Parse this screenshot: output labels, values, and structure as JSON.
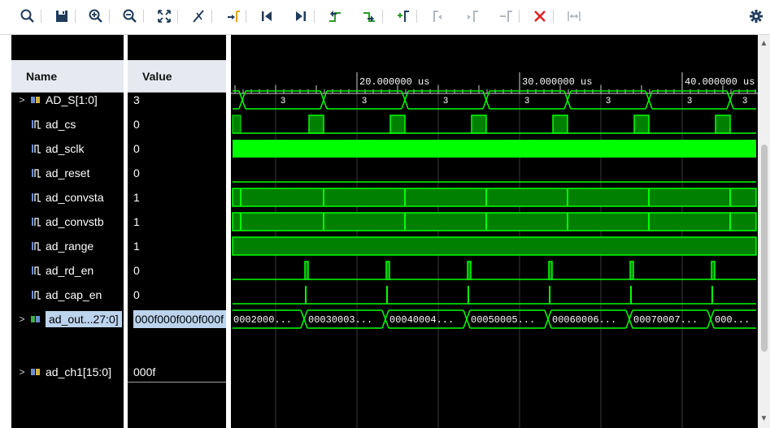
{
  "toolbar": {
    "buttons": [
      {
        "name": "search-icon",
        "title": "Search"
      },
      {
        "name": "save-icon",
        "title": "Save Waveform Configuration"
      },
      {
        "name": "zoom-in-icon",
        "title": "Zoom In"
      },
      {
        "name": "zoom-out-icon",
        "title": "Zoom Out"
      },
      {
        "name": "zoom-fit-icon",
        "title": "Zoom Fit"
      },
      {
        "name": "cursor-to-transition-icon",
        "title": "Zoom to Cursor"
      },
      {
        "name": "go-to-cursor-icon",
        "title": "Go To Cursor"
      },
      {
        "name": "go-to-time-zero-icon",
        "title": "Go To Time 0"
      },
      {
        "name": "go-to-last-time-icon",
        "title": "Go To Last Time"
      },
      {
        "name": "previous-transition-icon",
        "title": "Previous Transition"
      },
      {
        "name": "next-transition-icon",
        "title": "Next Transition"
      },
      {
        "name": "add-marker-icon",
        "title": "Add Marker"
      },
      {
        "name": "previous-marker-icon",
        "title": "Previous Marker"
      },
      {
        "name": "next-marker-icon",
        "title": "Next Marker"
      },
      {
        "name": "swap-cursors-icon",
        "title": "Swap Cursors"
      },
      {
        "name": "delete-icon",
        "title": "Delete"
      },
      {
        "name": "snap-to-transition-icon",
        "title": "Snap to Transition"
      },
      {
        "name": "settings-icon",
        "title": "Settings"
      }
    ]
  },
  "columns": {
    "name": "Name",
    "value": "Value"
  },
  "signals": [
    {
      "name": "AD_S[1:0]",
      "value": "3",
      "type": "bus",
      "expandable": true
    },
    {
      "name": "ad_cs",
      "value": "0",
      "type": "bit"
    },
    {
      "name": "ad_sclk",
      "value": "0",
      "type": "bit"
    },
    {
      "name": "ad_reset",
      "value": "0",
      "type": "bit"
    },
    {
      "name": "ad_convsta",
      "value": "1",
      "type": "bit"
    },
    {
      "name": "ad_convstb",
      "value": "1",
      "type": "bit"
    },
    {
      "name": "ad_range",
      "value": "1",
      "type": "bit"
    },
    {
      "name": "ad_rd_en",
      "value": "0",
      "type": "bit"
    },
    {
      "name": "ad_cap_en",
      "value": "0",
      "type": "bit"
    },
    {
      "name": "ad_out...27:0]",
      "value": "000f000f000f000f",
      "type": "bus",
      "expandable": true,
      "selected": true
    },
    {
      "name": "ad_ch1[15:0]",
      "value": "000f",
      "type": "bus",
      "expandable": true
    }
  ],
  "timeline": {
    "labels": [
      "20.000000 us",
      "30.000000 us",
      "40.000000 us"
    ],
    "bus_AD_S_value": "3",
    "bus_ad_out_values": [
      "0002000...",
      "00030003...",
      "00040004...",
      "00050005...",
      "00060006...",
      "00070007...",
      "000..."
    ]
  },
  "colors": {
    "wave": "#00ff00",
    "wave_dim": "#008000",
    "background": "#000000",
    "selection": "#bcd4ee",
    "delete_red": "#e02020"
  }
}
